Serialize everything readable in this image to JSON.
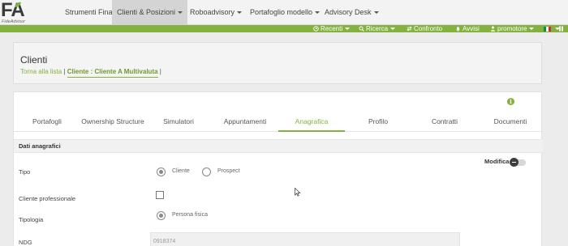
{
  "logo": {
    "letters": "FA",
    "subtitle": "FideAdvisor"
  },
  "topnav": {
    "items": [
      {
        "label": "Strumenti Finanziari"
      },
      {
        "label": "Clienti & Posizioni"
      },
      {
        "label": "Roboadvisory"
      },
      {
        "label": "Portafoglio modello"
      },
      {
        "label": "Advisory Desk"
      }
    ]
  },
  "toolbar": {
    "recenti": "Recenti",
    "ricerca": "Ricerca",
    "confronto": "Confronto",
    "avvisi": "Avvisi",
    "user": "promotore",
    "accent": "#84b241"
  },
  "header": {
    "title": "Clienti",
    "back_link": "Torna alla lista",
    "sep1": "|",
    "current": "Cliente : Cliente A Multivaluta",
    "sep2": "|"
  },
  "tabs": [
    {
      "label": "Portafogli"
    },
    {
      "label": "Ownership Structure"
    },
    {
      "label": "Simulatori"
    },
    {
      "label": "Appuntamenti"
    },
    {
      "label": "Anagrafica",
      "active": true
    },
    {
      "label": "Profilo"
    },
    {
      "label": "Contratti"
    },
    {
      "label": "Documenti"
    }
  ],
  "section": {
    "title": "Dati anagrafici"
  },
  "modifica": {
    "label": "Modifica",
    "enabled": false
  },
  "form": {
    "tipo": {
      "label": "Tipo",
      "options": [
        "Cliente",
        "Prospect"
      ],
      "selected": "Cliente"
    },
    "professionale": {
      "label": "Cliente professionale",
      "checked": false
    },
    "tipologia": {
      "label": "Tipologia",
      "option": "Persona fisica",
      "selected": true
    },
    "ndg": {
      "label": "NDG",
      "value": "0918374"
    }
  }
}
